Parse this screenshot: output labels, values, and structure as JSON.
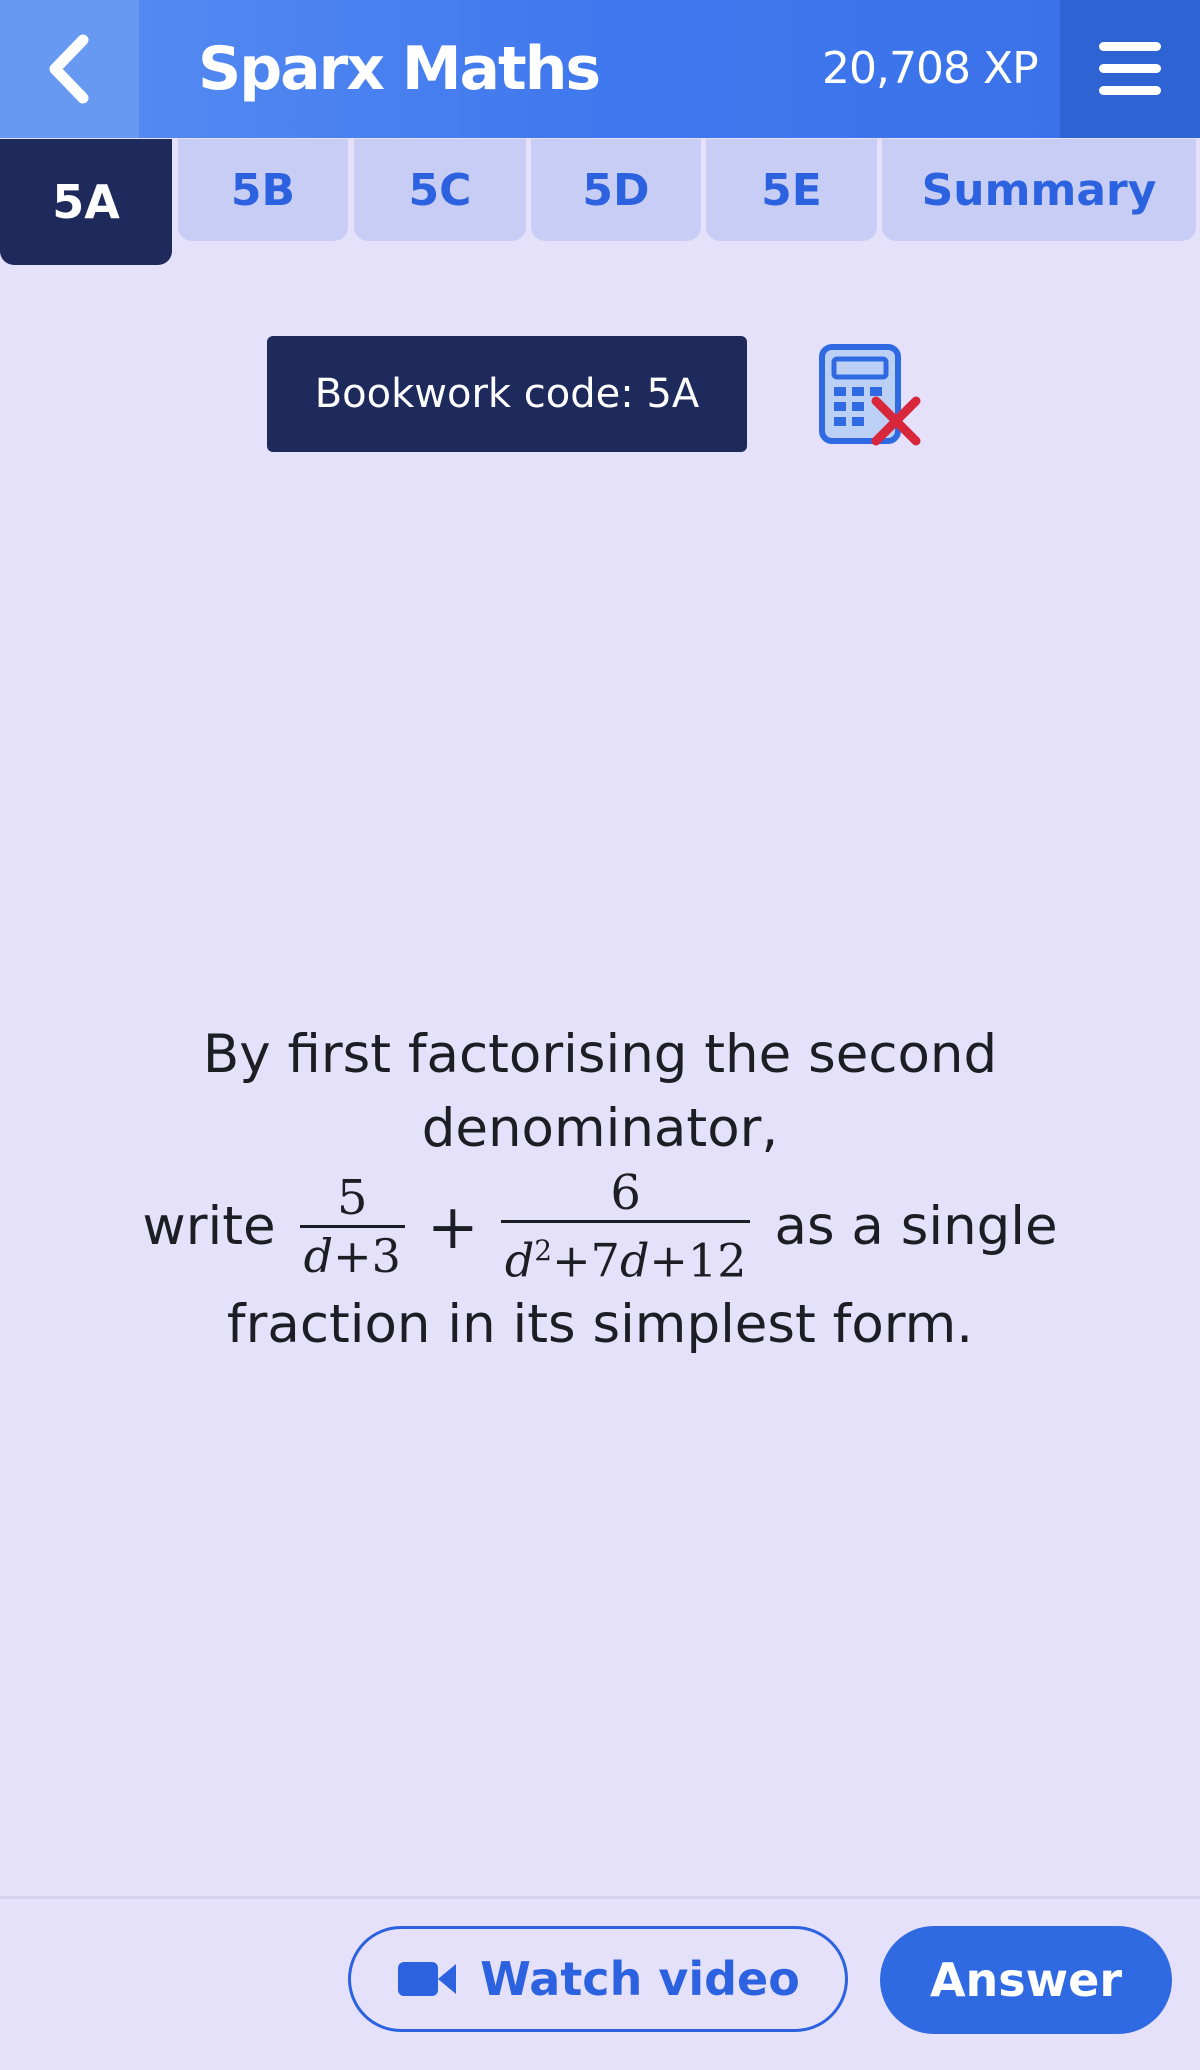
{
  "header": {
    "title": "Sparx Maths",
    "xp": "20,708 XP",
    "back_icon": "chevron-left-icon",
    "menu_icon": "hamburger-menu-icon"
  },
  "tabs": [
    {
      "label": "5A",
      "active": true
    },
    {
      "label": "5B",
      "active": false
    },
    {
      "label": "5C",
      "active": false
    },
    {
      "label": "5D",
      "active": false
    },
    {
      "label": "5E",
      "active": false
    },
    {
      "label": "Summary",
      "active": false
    }
  ],
  "bookwork": {
    "label": "Bookwork code: 5A",
    "calculator_icon": "calculator-not-allowed-icon"
  },
  "question": {
    "line1": "By first factorising the second",
    "line2": "denominator,",
    "pre": "write",
    "frac1_num": "5",
    "frac1_den_var": "d",
    "frac1_den_rest": "+3",
    "plus": "+",
    "frac2_num": "6",
    "frac2_den_var1": "d",
    "frac2_den_sup": "2",
    "frac2_den_mid": "+7",
    "frac2_den_var2": "d",
    "frac2_den_rest": "+12",
    "post": "as a single",
    "line4": "fraction in its simplest form."
  },
  "footer": {
    "watch_label": "Watch video",
    "answer_label": "Answer",
    "video_icon": "video-camera-icon"
  },
  "colors": {
    "background": "#e5e1fb",
    "header_blue": "#3f78ee",
    "navy": "#1f2a5c",
    "accent": "#2c62e0",
    "calc_cross": "#d8263a"
  }
}
